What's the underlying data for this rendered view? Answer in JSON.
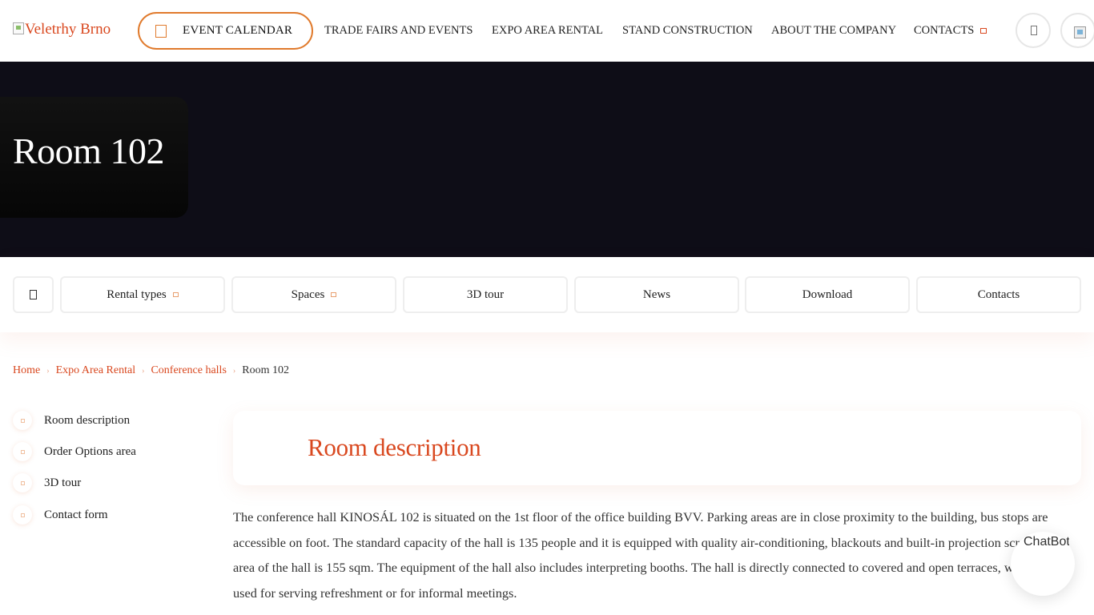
{
  "header": {
    "logo_alt": "Veletrhy Brno",
    "event_calendar": "EVENT CALENDAR",
    "nav": [
      {
        "label": "TRADE FAIRS AND EVENTS"
      },
      {
        "label": "EXPO AREA RENTAL"
      },
      {
        "label": "STAND CONSTRUCTION"
      },
      {
        "label": "ABOUT THE COMPANY"
      },
      {
        "label": "CONTACTS"
      }
    ]
  },
  "hero": {
    "title": "Room 102"
  },
  "subnav": {
    "items": [
      {
        "label": "Rental types"
      },
      {
        "label": "Spaces"
      },
      {
        "label": "3D tour"
      },
      {
        "label": "News"
      },
      {
        "label": "Download"
      },
      {
        "label": "Contacts"
      }
    ]
  },
  "breadcrumb": {
    "items": [
      "Home",
      "Expo Area Rental",
      "Conference halls"
    ],
    "current": "Room 102"
  },
  "side_menu": {
    "items": [
      "Room description",
      "Order Options area",
      "3D tour",
      "Contact form"
    ]
  },
  "content": {
    "heading": "Room description",
    "paragraph": "The conference hall KINOSÁL 102 is situated on the 1st floor of the office building BVV. Parking areas are in close proximity to the building, bus stops are accessible on foot. The standard capacity of the hall is 135 people and it is equipped with quality air-conditioning, blackouts and built-in projection screen. The area of the hall is 155 sqm. The equipment of the hall also includes interpreting booths. The hall is directly connected to covered and open terraces, which can be used for serving refreshment or for informal meetings."
  },
  "chatbot": {
    "label": "ChatBot"
  },
  "colors": {
    "accent": "#d9481f",
    "calendar_border": "#e07a2c",
    "hero_bg": "#0e0d17"
  },
  "icons": [
    "calendar-icon",
    "search-icon",
    "language-flag-icon",
    "home-icon"
  ]
}
